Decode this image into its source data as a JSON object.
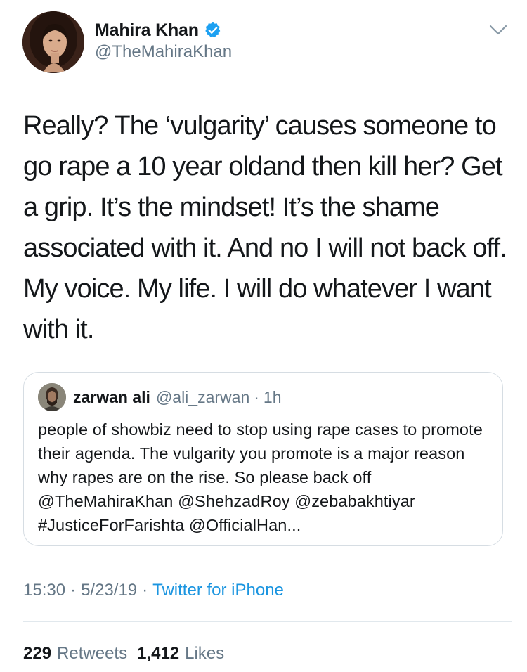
{
  "tweet": {
    "author": {
      "display_name": "Mahira Khan",
      "handle": "@TheMahiraKhan",
      "verified": true
    },
    "text": "Really? The ‘vulgarity’ causes someone to go rape a 10 year oldand then kill her? Get a grip. It’s the mindset! It’s the shame associated with it. And no I will not back off. My voice. My life. I will do whatever I want with it.",
    "quoted_tweet": {
      "display_name": "zarwan ali",
      "handle": "@ali_zarwan",
      "separator": "·",
      "time": "1h",
      "text": "people of showbiz need to stop using rape cases to promote their agenda. The vulgarity you promote is a major reason why rapes are on the rise. So please back off @TheMahiraKhan @ShehzadRoy @zebabakhtiyar #JusticeForFarishta @OfficialHan..."
    },
    "meta": {
      "time": "15:30",
      "separator": "·",
      "date": "5/23/19",
      "source": "Twitter for iPhone"
    },
    "stats": {
      "retweets_count": "229",
      "retweets_label": "Retweets",
      "likes_count": "1,412",
      "likes_label": "Likes"
    }
  },
  "icons": {
    "verified": "verified-badge-icon",
    "menu": "chevron-down-icon"
  },
  "colors": {
    "text_primary": "#14171a",
    "text_secondary": "#657786",
    "link": "#1b95e0",
    "verified_blue": "#1da1f2",
    "border": "#d6dde3"
  }
}
